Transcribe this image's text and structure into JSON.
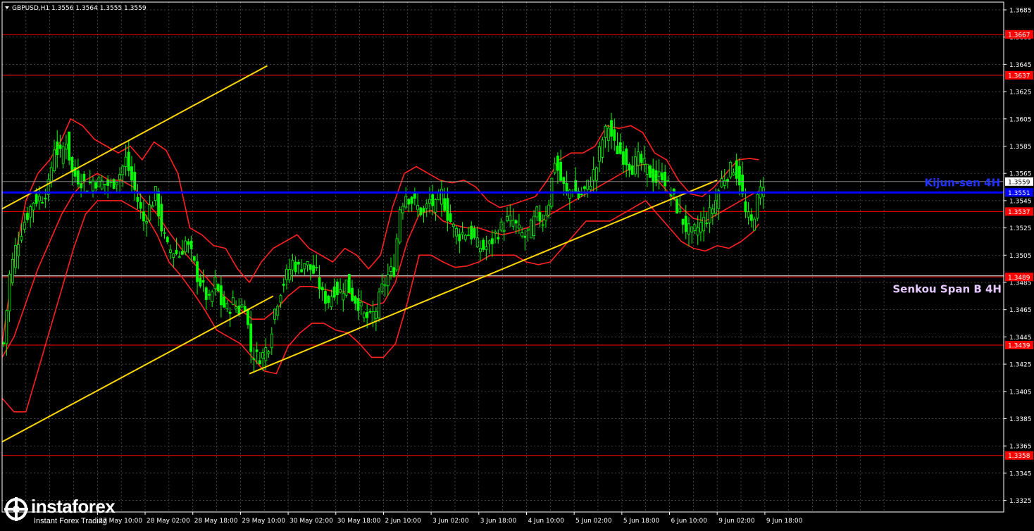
{
  "header": {
    "symbol": "GBPUSD,H1",
    "ohlc": "1.3556 1.3564 1.3555 1.3559"
  },
  "colors": {
    "background": "#000000",
    "candles": "#00ff00",
    "grid": "#5a5a5a",
    "levels": "#ff0000",
    "kijun": "#0000ff",
    "channel": "#ffd700",
    "bands": "#ff2020",
    "senkou_label": "#e6c8ff",
    "kijun_label": "#2233ff"
  },
  "labels": {
    "kijun": "Kijun-sen 4H",
    "senkou": "Senkou Span B 4H"
  },
  "watermark": {
    "brand": "instaforex",
    "tagline": "Instant Forex Trading"
  },
  "chart_data": {
    "type": "line",
    "subtype": "candlestick",
    "y_axis_ticks": [
      "1.3685",
      "1.3665",
      "1.3645",
      "1.3625",
      "1.3605",
      "1.3585",
      "1.3565",
      "1.3545",
      "1.3525",
      "1.3505",
      "1.3485",
      "1.3465",
      "1.3445",
      "1.3425",
      "1.3405",
      "1.3385",
      "1.3365",
      "1.3345",
      "1.3325"
    ],
    "ylim": [
      1.3318,
      1.3694
    ],
    "current_price": "1.3559",
    "x_ticks": [
      {
        "label": "27 May 10:00",
        "bar": 32
      },
      {
        "label": "28 May 02:00",
        "bar": 48
      },
      {
        "label": "28 May 18:00",
        "bar": 64
      },
      {
        "label": "29 May 10:00",
        "bar": 80
      },
      {
        "label": "30 May 02:00",
        "bar": 96
      },
      {
        "label": "30 May 18:00",
        "bar": 112
      },
      {
        "label": "2 Jun 10:00",
        "bar": 128
      },
      {
        "label": "3 Jun 02:00",
        "bar": 144
      },
      {
        "label": "3 Jun 18:00",
        "bar": 160
      },
      {
        "label": "4 Jun 10:00",
        "bar": 176
      },
      {
        "label": "5 Jun 02:00",
        "bar": 192
      },
      {
        "label": "5 Jun 18:00",
        "bar": 208
      },
      {
        "label": "6 Jun 10:00",
        "bar": 224
      },
      {
        "label": "9 Jun 02:00",
        "bar": 240
      },
      {
        "label": "9 Jun 18:00",
        "bar": 256
      }
    ],
    "levels": [
      {
        "label": "1.3667",
        "value": 1.3667
      },
      {
        "label": "1.3637",
        "value": 1.3637
      },
      {
        "label": "1.3537",
        "value": 1.3537
      },
      {
        "label": "1.3489",
        "value": 1.3489
      },
      {
        "label": "1.3439",
        "value": 1.3439
      },
      {
        "label": "1.3358",
        "value": 1.3358
      }
    ],
    "kijun_level": {
      "label": "1.3551",
      "value": 1.3551
    },
    "senkou_level": {
      "value": 1.3489
    },
    "trend_lines": [
      {
        "from": [
          0,
          1.3539
        ],
        "to": [
          89,
          1.3644
        ]
      },
      {
        "from": [
          0,
          1.3368
        ],
        "to": [
          91,
          1.3475
        ]
      },
      {
        "from": [
          83,
          1.3418
        ],
        "to": [
          240,
          1.356
        ]
      }
    ],
    "path": [
      [
        0,
        1.344
      ],
      [
        2,
        1.349
      ],
      [
        4,
        1.351
      ],
      [
        7,
        1.353
      ],
      [
        10,
        1.3545
      ],
      [
        13,
        1.3548
      ],
      [
        15,
        1.3555
      ],
      [
        17,
        1.3585
      ],
      [
        19,
        1.3578
      ],
      [
        21,
        1.359
      ],
      [
        23,
        1.3565
      ],
      [
        26,
        1.356
      ],
      [
        28,
        1.3555
      ],
      [
        30,
        1.356
      ],
      [
        33,
        1.3558
      ],
      [
        36,
        1.3556
      ],
      [
        39,
        1.3565
      ],
      [
        41,
        1.3575
      ],
      [
        43,
        1.356
      ],
      [
        45,
        1.3545
      ],
      [
        47,
        1.353
      ],
      [
        49,
        1.354
      ],
      [
        51,
        1.355
      ],
      [
        53,
        1.3525
      ],
      [
        55,
        1.351
      ],
      [
        57,
        1.3508
      ],
      [
        59,
        1.3505
      ],
      [
        61,
        1.3515
      ],
      [
        63,
        1.3505
      ],
      [
        65,
        1.349
      ],
      [
        67,
        1.348
      ],
      [
        69,
        1.347
      ],
      [
        71,
        1.3485
      ],
      [
        73,
        1.347
      ],
      [
        75,
        1.3465
      ],
      [
        77,
        1.347
      ],
      [
        79,
        1.3465
      ],
      [
        81,
        1.347
      ],
      [
        83,
        1.3435
      ],
      [
        85,
        1.343
      ],
      [
        87,
        1.3432
      ],
      [
        89,
        1.344
      ],
      [
        91,
        1.3465
      ],
      [
        93,
        1.348
      ],
      [
        95,
        1.349
      ],
      [
        97,
        1.35
      ],
      [
        99,
        1.3495
      ],
      [
        101,
        1.35
      ],
      [
        103,
        1.3495
      ],
      [
        105,
        1.349
      ],
      [
        107,
        1.3475
      ],
      [
        109,
        1.3472
      ],
      [
        111,
        1.348
      ],
      [
        113,
        1.3478
      ],
      [
        115,
        1.3485
      ],
      [
        117,
        1.3475
      ],
      [
        119,
        1.347
      ],
      [
        121,
        1.346
      ],
      [
        123,
        1.3458
      ],
      [
        125,
        1.3465
      ],
      [
        127,
        1.348
      ],
      [
        129,
        1.349
      ],
      [
        131,
        1.3495
      ],
      [
        133,
        1.354
      ],
      [
        135,
        1.355
      ],
      [
        137,
        1.3545
      ],
      [
        139,
        1.354
      ],
      [
        141,
        1.3535
      ],
      [
        143,
        1.3545
      ],
      [
        145,
        1.354
      ],
      [
        147,
        1.355
      ],
      [
        149,
        1.3535
      ],
      [
        151,
        1.3525
      ],
      [
        153,
        1.352
      ],
      [
        155,
        1.3522
      ],
      [
        157,
        1.352
      ],
      [
        159,
        1.3512
      ],
      [
        161,
        1.351
      ],
      [
        163,
        1.3512
      ],
      [
        165,
        1.352
      ],
      [
        167,
        1.3525
      ],
      [
        169,
        1.353
      ],
      [
        171,
        1.353
      ],
      [
        173,
        1.3522
      ],
      [
        175,
        1.3518
      ],
      [
        177,
        1.3525
      ],
      [
        179,
        1.3535
      ],
      [
        181,
        1.353
      ],
      [
        183,
        1.3545
      ],
      [
        185,
        1.3575
      ],
      [
        187,
        1.356
      ],
      [
        189,
        1.355
      ],
      [
        191,
        1.3555
      ],
      [
        193,
        1.3548
      ],
      [
        195,
        1.3552
      ],
      [
        197,
        1.356
      ],
      [
        199,
        1.357
      ],
      [
        201,
        1.359
      ],
      [
        203,
        1.36
      ],
      [
        205,
        1.3585
      ],
      [
        207,
        1.358
      ],
      [
        209,
        1.3575
      ],
      [
        211,
        1.357
      ],
      [
        213,
        1.3575
      ],
      [
        215,
        1.357
      ],
      [
        217,
        1.3565
      ],
      [
        219,
        1.356
      ],
      [
        221,
        1.3565
      ],
      [
        223,
        1.3555
      ],
      [
        225,
        1.3545
      ],
      [
        227,
        1.3535
      ],
      [
        229,
        1.3525
      ],
      [
        231,
        1.352
      ],
      [
        233,
        1.3525
      ],
      [
        235,
        1.353
      ],
      [
        237,
        1.3535
      ],
      [
        239,
        1.3545
      ],
      [
        241,
        1.356
      ],
      [
        243,
        1.3565
      ],
      [
        245,
        1.357
      ],
      [
        247,
        1.356
      ],
      [
        249,
        1.3535
      ],
      [
        251,
        1.3528
      ],
      [
        253,
        1.3545
      ],
      [
        255,
        1.3559
      ]
    ],
    "bands": {
      "upper": [
        [
          0,
          1.344
        ],
        [
          4,
          1.35
        ],
        [
          8,
          1.3545
        ],
        [
          12,
          1.3565
        ],
        [
          16,
          1.3575
        ],
        [
          20,
          1.359
        ],
        [
          23,
          1.3605
        ],
        [
          27,
          1.36
        ],
        [
          31,
          1.359
        ],
        [
          35,
          1.3585
        ],
        [
          39,
          1.358
        ],
        [
          43,
          1.3585
        ],
        [
          47,
          1.3575
        ],
        [
          51,
          1.3588
        ],
        [
          55,
          1.3582
        ],
        [
          59,
          1.3565
        ],
        [
          63,
          1.3525
        ],
        [
          67,
          1.352
        ],
        [
          71,
          1.3512
        ],
        [
          75,
          1.351
        ],
        [
          79,
          1.3495
        ],
        [
          83,
          1.3485
        ],
        [
          87,
          1.35
        ],
        [
          91,
          1.351
        ],
        [
          95,
          1.3515
        ],
        [
          99,
          1.352
        ],
        [
          103,
          1.351
        ],
        [
          107,
          1.3505
        ],
        [
          111,
          1.35
        ],
        [
          115,
          1.351
        ],
        [
          119,
          1.3505
        ],
        [
          123,
          1.3495
        ],
        [
          127,
          1.3505
        ],
        [
          131,
          1.354
        ],
        [
          135,
          1.3565
        ],
        [
          139,
          1.357
        ],
        [
          143,
          1.3565
        ],
        [
          147,
          1.356
        ],
        [
          151,
          1.3558
        ],
        [
          155,
          1.356
        ],
        [
          159,
          1.3555
        ],
        [
          163,
          1.3545
        ],
        [
          167,
          1.354
        ],
        [
          171,
          1.3542
        ],
        [
          175,
          1.3545
        ],
        [
          179,
          1.3548
        ],
        [
          183,
          1.356
        ],
        [
          187,
          1.3575
        ],
        [
          191,
          1.358
        ],
        [
          195,
          1.358
        ],
        [
          199,
          1.3585
        ],
        [
          203,
          1.36
        ],
        [
          207,
          1.3598
        ],
        [
          211,
          1.36
        ],
        [
          215,
          1.3595
        ],
        [
          219,
          1.358
        ],
        [
          223,
          1.3575
        ],
        [
          227,
          1.356
        ],
        [
          231,
          1.355
        ],
        [
          235,
          1.3548
        ],
        [
          239,
          1.3555
        ],
        [
          243,
          1.3565
        ],
        [
          247,
          1.3575
        ],
        [
          251,
          1.3576
        ],
        [
          254,
          1.3575
        ]
      ],
      "lower": [
        [
          0,
          1.34
        ],
        [
          4,
          1.339
        ],
        [
          8,
          1.339
        ],
        [
          12,
          1.342
        ],
        [
          16,
          1.345
        ],
        [
          20,
          1.348
        ],
        [
          24,
          1.351
        ],
        [
          28,
          1.3535
        ],
        [
          32,
          1.3545
        ],
        [
          36,
          1.3545
        ],
        [
          40,
          1.3545
        ],
        [
          44,
          1.354
        ],
        [
          48,
          1.3535
        ],
        [
          52,
          1.352
        ],
        [
          56,
          1.35
        ],
        [
          60,
          1.349
        ],
        [
          64,
          1.3478
        ],
        [
          68,
          1.3465
        ],
        [
          72,
          1.345
        ],
        [
          76,
          1.3445
        ],
        [
          80,
          1.344
        ],
        [
          84,
          1.343
        ],
        [
          88,
          1.342
        ],
        [
          92,
          1.3418
        ],
        [
          96,
          1.3438
        ],
        [
          100,
          1.3448
        ],
        [
          104,
          1.3455
        ],
        [
          108,
          1.3455
        ],
        [
          112,
          1.345
        ],
        [
          116,
          1.3448
        ],
        [
          120,
          1.344
        ],
        [
          124,
          1.343
        ],
        [
          128,
          1.343
        ],
        [
          132,
          1.344
        ],
        [
          136,
          1.347
        ],
        [
          140,
          1.3505
        ],
        [
          144,
          1.3505
        ],
        [
          148,
          1.35
        ],
        [
          152,
          1.3496
        ],
        [
          156,
          1.3497
        ],
        [
          160,
          1.35
        ],
        [
          164,
          1.3505
        ],
        [
          168,
          1.3505
        ],
        [
          172,
          1.3505
        ],
        [
          176,
          1.35
        ],
        [
          180,
          1.3498
        ],
        [
          184,
          1.35
        ],
        [
          188,
          1.351
        ],
        [
          192,
          1.352
        ],
        [
          196,
          1.353
        ],
        [
          200,
          1.353
        ],
        [
          204,
          1.353
        ],
        [
          208,
          1.3535
        ],
        [
          212,
          1.354
        ],
        [
          216,
          1.3545
        ],
        [
          220,
          1.3535
        ],
        [
          224,
          1.3525
        ],
        [
          228,
          1.3515
        ],
        [
          232,
          1.351
        ],
        [
          236,
          1.3508
        ],
        [
          240,
          1.3512
        ],
        [
          244,
          1.351
        ],
        [
          248,
          1.3515
        ],
        [
          252,
          1.3522
        ],
        [
          254,
          1.3528
        ]
      ],
      "middle": [
        [
          0,
          1.343
        ],
        [
          4,
          1.3445
        ],
        [
          8,
          1.347
        ],
        [
          12,
          1.3495
        ],
        [
          16,
          1.3515
        ],
        [
          20,
          1.3535
        ],
        [
          24,
          1.355
        ],
        [
          28,
          1.356
        ],
        [
          32,
          1.3565
        ],
        [
          36,
          1.356
        ],
        [
          40,
          1.356
        ],
        [
          44,
          1.3555
        ],
        [
          48,
          1.3545
        ],
        [
          52,
          1.3535
        ],
        [
          56,
          1.3522
        ],
        [
          60,
          1.351
        ],
        [
          64,
          1.35
        ],
        [
          68,
          1.349
        ],
        [
          72,
          1.348
        ],
        [
          76,
          1.3472
        ],
        [
          80,
          1.3465
        ],
        [
          84,
          1.3458
        ],
        [
          88,
          1.3458
        ],
        [
          92,
          1.3465
        ],
        [
          96,
          1.3475
        ],
        [
          100,
          1.3482
        ],
        [
          104,
          1.3482
        ],
        [
          108,
          1.348
        ],
        [
          112,
          1.3478
        ],
        [
          116,
          1.3478
        ],
        [
          120,
          1.3472
        ],
        [
          124,
          1.3468
        ],
        [
          128,
          1.347
        ],
        [
          132,
          1.3485
        ],
        [
          136,
          1.3515
        ],
        [
          140,
          1.3535
        ],
        [
          144,
          1.3538
        ],
        [
          148,
          1.353
        ],
        [
          152,
          1.3527
        ],
        [
          156,
          1.3525
        ],
        [
          160,
          1.3525
        ],
        [
          164,
          1.3522
        ],
        [
          168,
          1.352
        ],
        [
          172,
          1.3522
        ],
        [
          176,
          1.3525
        ],
        [
          180,
          1.3528
        ],
        [
          184,
          1.3535
        ],
        [
          188,
          1.354
        ],
        [
          192,
          1.3545
        ],
        [
          196,
          1.355
        ],
        [
          200,
          1.3555
        ],
        [
          204,
          1.356
        ],
        [
          208,
          1.3565
        ],
        [
          212,
          1.357
        ],
        [
          216,
          1.3572
        ],
        [
          220,
          1.356
        ],
        [
          224,
          1.355
        ],
        [
          228,
          1.354
        ],
        [
          232,
          1.3532
        ],
        [
          236,
          1.353
        ],
        [
          240,
          1.3535
        ],
        [
          244,
          1.354
        ],
        [
          248,
          1.3545
        ],
        [
          252,
          1.355
        ],
        [
          254,
          1.3552
        ]
      ]
    }
  }
}
